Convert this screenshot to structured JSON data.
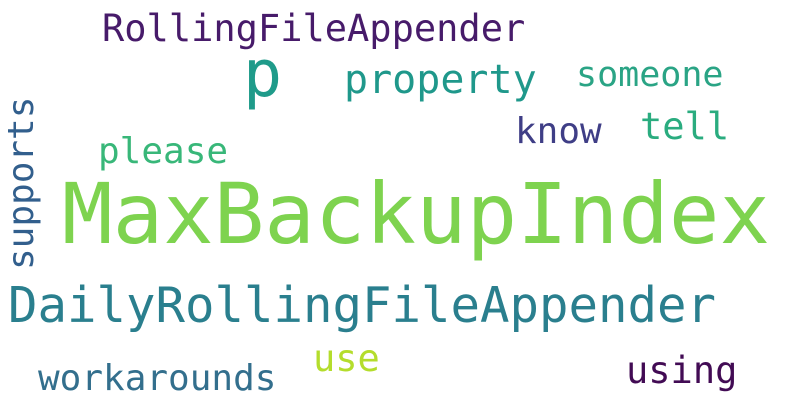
{
  "word_cloud": {
    "background": "#ffffff",
    "words": [
      {
        "id": "maxbackupindex",
        "text": "MaxBackupIndex",
        "color": "#7ed34f",
        "orientation": "horizontal"
      },
      {
        "id": "daily",
        "text": "DailyRollingFileAppender",
        "color": "#2a7f8e",
        "orientation": "horizontal"
      },
      {
        "id": "rolling",
        "text": "RollingFileAppender",
        "color": "#471b6a",
        "orientation": "horizontal"
      },
      {
        "id": "p",
        "text": "p",
        "color": "#1f9b8a",
        "orientation": "horizontal"
      },
      {
        "id": "property",
        "text": "property",
        "color": "#1f988b",
        "orientation": "horizontal"
      },
      {
        "id": "someone",
        "text": "someone",
        "color": "#2aa485",
        "orientation": "horizontal"
      },
      {
        "id": "tell",
        "text": "tell",
        "color": "#2aac7f",
        "orientation": "horizontal"
      },
      {
        "id": "know",
        "text": "know",
        "color": "#3f3e86",
        "orientation": "horizontal"
      },
      {
        "id": "please",
        "text": "please",
        "color": "#38b779",
        "orientation": "horizontal"
      },
      {
        "id": "supports",
        "text": "supports",
        "color": "#325f8d",
        "orientation": "vertical"
      },
      {
        "id": "use",
        "text": "use",
        "color": "#b4dd2c",
        "orientation": "horizontal"
      },
      {
        "id": "using",
        "text": "using",
        "color": "#420b54",
        "orientation": "horizontal"
      },
      {
        "id": "workarounds",
        "text": "workarounds",
        "color": "#336f8d",
        "orientation": "horizontal"
      }
    ]
  }
}
